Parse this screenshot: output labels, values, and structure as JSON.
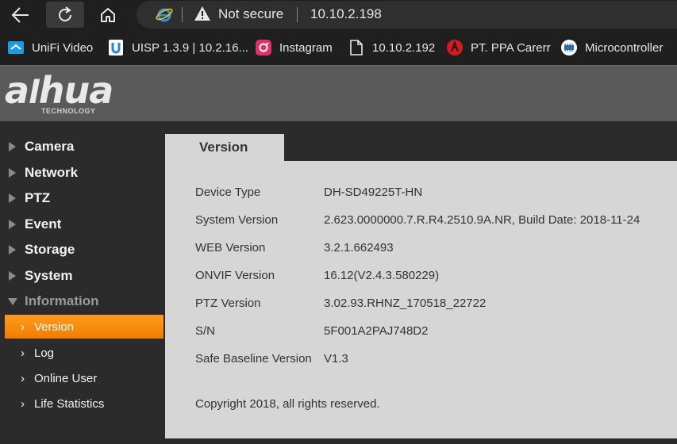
{
  "browser": {
    "security_label": "Not secure",
    "url": "10.10.2.198"
  },
  "bookmarks": [
    {
      "label": "UniFi Video",
      "icon": "unifi-video-icon"
    },
    {
      "label": "UISP 1.3.9 | 10.2.16...",
      "icon": "uisp-icon"
    },
    {
      "label": "Instagram",
      "icon": "instagram-icon"
    },
    {
      "label": "10.10.2.192",
      "icon": "page-icon"
    },
    {
      "label": "PT. PPA Carerr",
      "icon": "ppa-icon"
    },
    {
      "label": "Microcontroller",
      "icon": "microcontroller-icon"
    }
  ],
  "logo": {
    "brand": "alhua",
    "tagline": "TECHNOLOGY"
  },
  "sidebar": {
    "menu": [
      {
        "label": "Camera"
      },
      {
        "label": "Network"
      },
      {
        "label": "PTZ"
      },
      {
        "label": "Event"
      },
      {
        "label": "Storage"
      },
      {
        "label": "System"
      },
      {
        "label": "Information"
      }
    ],
    "submenu": [
      {
        "label": "Version"
      },
      {
        "label": "Log"
      },
      {
        "label": "Online User"
      },
      {
        "label": "Life Statistics"
      }
    ]
  },
  "content": {
    "tab": "Version",
    "rows": [
      {
        "label": "Device Type",
        "value": "DH-SD49225T-HN"
      },
      {
        "label": "System Version",
        "value": "2.623.0000000.7.R.R4.2510.9A.NR, Build Date: 2018-11-24"
      },
      {
        "label": "WEB Version",
        "value": "3.2.1.662493"
      },
      {
        "label": "ONVIF Version",
        "value": "16.12(V2.4.3.580229)"
      },
      {
        "label": "PTZ Version",
        "value": "3.02.93.RHNZ_170518_22722"
      },
      {
        "label": "S/N",
        "value": "5F001A2PAJ748D2"
      },
      {
        "label": "Safe Baseline Version",
        "value": "V1.3"
      }
    ],
    "copyright": "Copyright 2018, all rights reserved."
  },
  "colors": {
    "accent": "#f28a0c",
    "sidebar_bg": "#2b2b2b",
    "panel_bg": "#d6d6d6",
    "header_bg": "#5a5a5a"
  }
}
